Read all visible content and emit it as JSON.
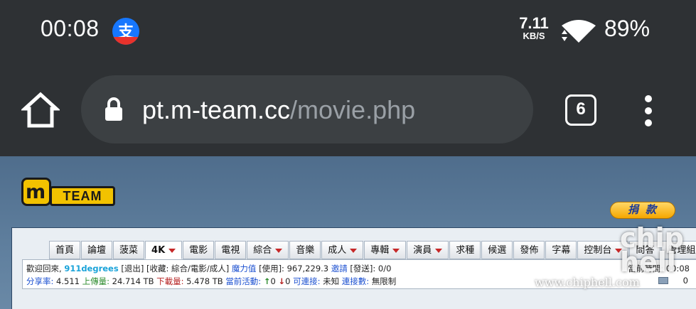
{
  "status_bar": {
    "time": "00:08",
    "network_speed": "7.11",
    "network_speed_unit": "KB/S",
    "battery": "89%",
    "notification_icons": [
      "alipay-icon"
    ]
  },
  "browser": {
    "url_host": "pt.m-team.cc",
    "url_path": "/movie.php",
    "tab_count": "6"
  },
  "site": {
    "logo_letter": "m",
    "logo_text": "TEAM",
    "donate_label": "捐款",
    "nav": [
      {
        "label": "首頁",
        "dropdown": false
      },
      {
        "label": "論壇",
        "dropdown": false
      },
      {
        "label": "菠菜",
        "dropdown": false
      },
      {
        "label": "4K",
        "dropdown": true
      },
      {
        "label": "電影",
        "dropdown": false
      },
      {
        "label": "電視",
        "dropdown": false
      },
      {
        "label": "綜合",
        "dropdown": true
      },
      {
        "label": "音樂",
        "dropdown": false
      },
      {
        "label": "成人",
        "dropdown": true
      },
      {
        "label": "專輯",
        "dropdown": true
      },
      {
        "label": "演員",
        "dropdown": true
      },
      {
        "label": "求種",
        "dropdown": false
      },
      {
        "label": "候選",
        "dropdown": false
      },
      {
        "label": "發佈",
        "dropdown": false
      },
      {
        "label": "字幕",
        "dropdown": false
      },
      {
        "label": "控制台",
        "dropdown": true
      },
      {
        "label": "問答",
        "dropdown": false
      },
      {
        "label": "管理組",
        "dropdown": false
      }
    ],
    "info": {
      "welcome": "歡迎回來,",
      "username": "911degrees",
      "logout": "[退出]",
      "favorites": "[收藏: 綜合/電影/成人]",
      "bonus_label": "魔力值",
      "bonus_value": "[使用]: 967,229.3",
      "invite_label": "邀請",
      "sent": "[發送]: 0/0",
      "ratio_label": "分享率:",
      "ratio_value": "4.511",
      "upload_label": "上傳量:",
      "upload_value": "24.714 TB",
      "download_label": "下載量:",
      "download_value": "5.478 TB",
      "active_label": "當前活動:",
      "active_seeding": "0",
      "active_leeching": "0",
      "connectable_label": "可連接:",
      "connectable_value": "未知",
      "connections_label": "連接數:",
      "connections_value": "無限制",
      "current_time_label": "當前時間",
      "current_time_value": "00:08",
      "messages_value": "0"
    }
  },
  "watermark": {
    "text": "www.chiphell.com",
    "logo_text": "chip hell"
  }
}
